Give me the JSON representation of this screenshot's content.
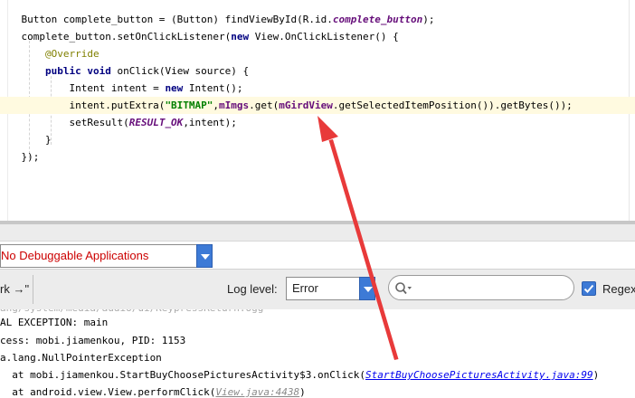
{
  "editor": {
    "lines": [
      [
        {
          "t": "    Button complete_button = (Button) findViewById(R.id."
        },
        {
          "t": "complete_button",
          "c": "cst"
        },
        {
          "t": ");"
        }
      ],
      [
        {
          "t": "    complete_button.setOnClickListener("
        },
        {
          "t": "new",
          "c": "kw"
        },
        {
          "t": " View.OnClickListener() {"
        }
      ],
      [
        {
          "t": "        "
        },
        {
          "t": "@Override",
          "c": "ann"
        }
      ],
      [
        {
          "t": "        "
        },
        {
          "t": "public void",
          "c": "kw"
        },
        {
          "t": " onClick(View source) {"
        }
      ],
      [
        {
          "t": "            Intent intent = "
        },
        {
          "t": "new",
          "c": "kw"
        },
        {
          "t": " Intent();"
        }
      ],
      [
        {
          "t": "            intent.putExtra("
        },
        {
          "t": "\"BITMAP\"",
          "c": "str"
        },
        {
          "t": ","
        },
        {
          "t": "mImgs",
          "c": "fld"
        },
        {
          "t": ".get("
        },
        {
          "t": "mGirdView",
          "c": "fld"
        },
        {
          "t": ".getSelectedItemPosition()).getBytes());"
        }
      ],
      [
        {
          "t": "            setResult("
        },
        {
          "t": "RESULT_OK",
          "c": "cst"
        },
        {
          "t": ",intent);"
        }
      ],
      [
        {
          "t": "        }"
        }
      ],
      [
        {
          "t": "    });"
        }
      ],
      [
        {
          "t": ""
        }
      ],
      [
        {
          "t": ""
        }
      ],
      [
        {
          "t": "}"
        }
      ]
    ]
  },
  "toolbar": {
    "app_selector": "No Debuggable Applications",
    "mark_label": "rk →\"",
    "log_level_label": "Log level:",
    "log_level_value": "Error",
    "search_placeholder": "",
    "regex_label": "Regex"
  },
  "log": {
    "lines": [
      [
        {
          "t": "cess: mobi.jiamenkou, PID: 1153"
        }
      ],
      [
        {
          "t": "a.lang.NullPointerException"
        }
      ],
      [
        {
          "t": "  at mobi.jiamenkou.StartBuyChoosePicturesActivity$3.onClick("
        },
        {
          "t": "StartBuyChoosePicturesActivity.java:99",
          "link": true
        },
        {
          "t": ")"
        }
      ],
      [
        {
          "t": "  at android.view.View.performClick("
        },
        {
          "t": "View.java:4438",
          "link": "dim"
        },
        {
          "t": ")"
        }
      ]
    ],
    "partial_top": "AL EXCEPTION: main"
  },
  "colors": {
    "arrow": "#e83a3a",
    "accent": "#3d7ad6",
    "error_text": "#cc0000"
  }
}
